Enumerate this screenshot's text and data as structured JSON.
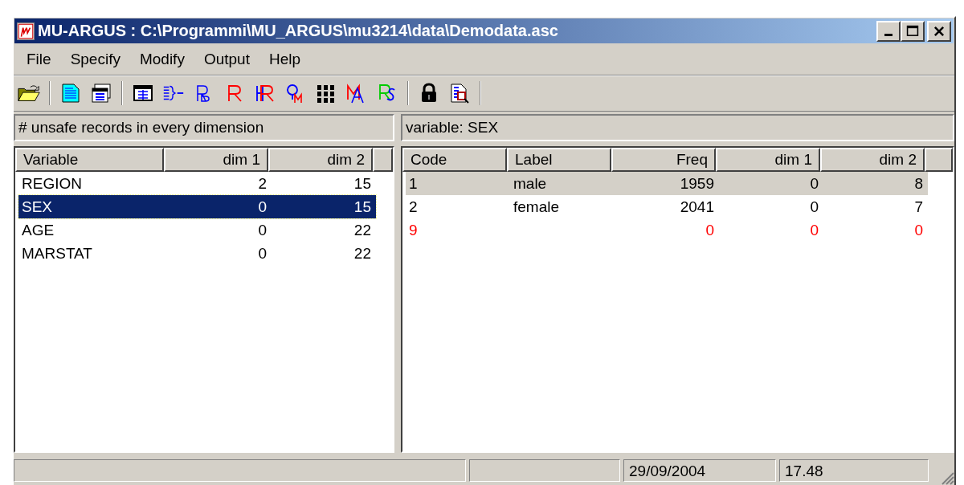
{
  "window": {
    "title": "MU-ARGUS : C:\\Programmi\\MU_ARGUS\\mu3214\\data\\Demodata.asc"
  },
  "menu": [
    "File",
    "Specify",
    "Modify",
    "Output",
    "Help"
  ],
  "left_panel": {
    "caption": "# unsafe records in every dimension",
    "columns": [
      {
        "label": "Variable",
        "numeric": false
      },
      {
        "label": "dim 1",
        "numeric": true
      },
      {
        "label": "dim 2",
        "numeric": true
      }
    ],
    "rows": [
      {
        "cells": [
          "REGION",
          "2",
          "15"
        ],
        "selected": false
      },
      {
        "cells": [
          "SEX",
          "0",
          "15"
        ],
        "selected": true
      },
      {
        "cells": [
          "AGE",
          "0",
          "22"
        ],
        "selected": false
      },
      {
        "cells": [
          "MARSTAT",
          "0",
          "22"
        ],
        "selected": false
      }
    ]
  },
  "right_panel": {
    "caption": "variable: SEX",
    "columns": [
      {
        "label": "Code",
        "numeric": false
      },
      {
        "label": "Label",
        "numeric": false
      },
      {
        "label": "Freq",
        "numeric": true
      },
      {
        "label": "dim 1",
        "numeric": true
      },
      {
        "label": "dim 2",
        "numeric": true
      }
    ],
    "rows": [
      {
        "cells": [
          "1",
          "male",
          "1959",
          "0",
          "8"
        ],
        "selected": true,
        "color": "#000000"
      },
      {
        "cells": [
          "2",
          "female",
          "2041",
          "0",
          "7"
        ],
        "selected": false,
        "color": "#000000"
      },
      {
        "cells": [
          "9",
          "",
          "0",
          "0",
          "0"
        ],
        "selected": false,
        "color": "#ff0000"
      }
    ]
  },
  "status_bar": {
    "date": "29/09/2004",
    "time": "17.48"
  }
}
